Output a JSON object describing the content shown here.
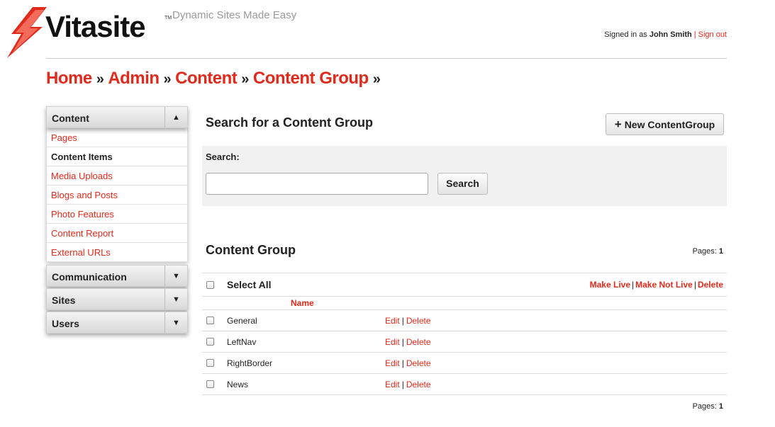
{
  "brand": {
    "name": "Vitasite",
    "tm": "TM",
    "tagline": "Dynamic Sites Made Easy",
    "accent": "#e02a1c"
  },
  "auth": {
    "signed_in_as": "Signed in as",
    "user": "John Smith",
    "separator": "|",
    "sign_out": "Sign out"
  },
  "breadcrumb": [
    {
      "label": "Home"
    },
    {
      "label": "Admin"
    },
    {
      "label": "Content"
    },
    {
      "label": "Content Group"
    }
  ],
  "breadcrumb_sep": "»",
  "sidebar": {
    "sections": [
      {
        "label": "Content",
        "toggle": "▲",
        "items": [
          {
            "label": "Pages"
          },
          {
            "label": "Content Items",
            "active": true
          },
          {
            "label": "Media Uploads"
          },
          {
            "label": "Blogs and Posts"
          },
          {
            "label": "Photo Features"
          },
          {
            "label": "Content Report"
          },
          {
            "label": "External URLs"
          }
        ]
      },
      {
        "label": "Communication",
        "toggle": "▼"
      },
      {
        "label": "Sites",
        "toggle": "▼"
      },
      {
        "label": "Users",
        "toggle": "▼"
      }
    ]
  },
  "main": {
    "title": "Search for a Content Group",
    "new_button": "New ContentGroup",
    "search_label": "Search:",
    "search_value": "",
    "search_button": "Search",
    "list_title": "Content Group",
    "pages_label": "Pages:",
    "pages_value": "1",
    "select_all": "Select All",
    "bulk_actions": [
      "Make Live",
      "Make Not Live",
      "Delete"
    ],
    "column_name": "Name",
    "rows": [
      {
        "name": "General",
        "edit": "Edit",
        "delete": "Delete"
      },
      {
        "name": "LeftNav",
        "edit": "Edit",
        "delete": "Delete"
      },
      {
        "name": "RightBorder",
        "edit": "Edit",
        "delete": "Delete"
      },
      {
        "name": "News",
        "edit": "Edit",
        "delete": "Delete"
      }
    ]
  }
}
